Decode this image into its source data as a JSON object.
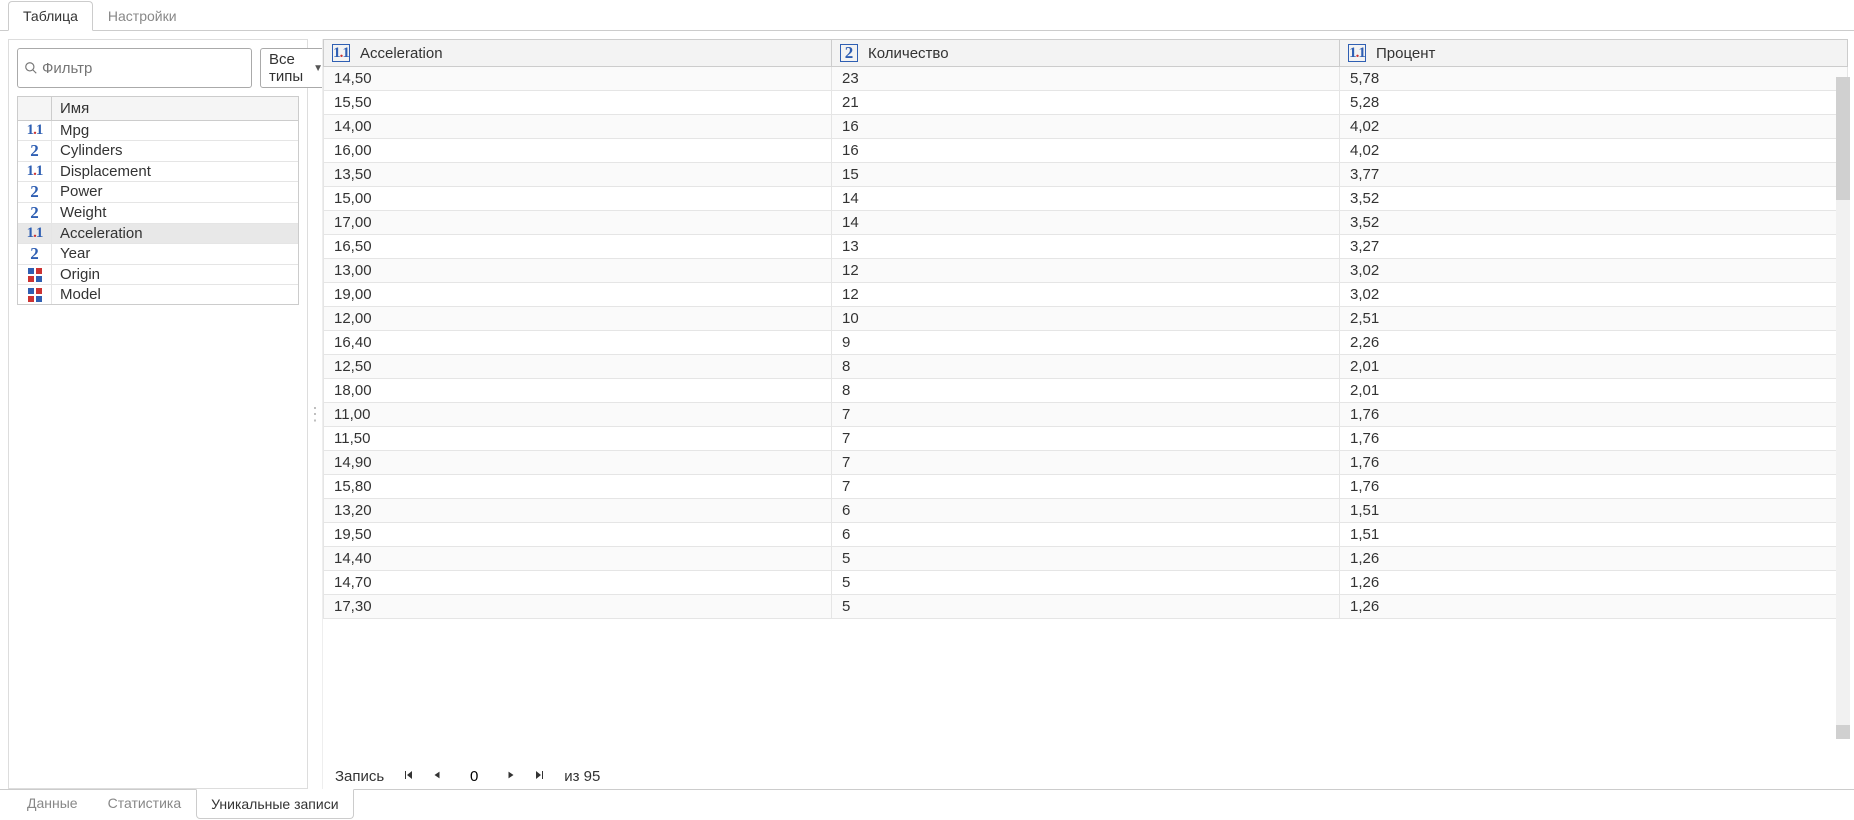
{
  "top_tabs": [
    {
      "label": "Таблица",
      "active": true
    },
    {
      "label": "Настройки",
      "active": false
    }
  ],
  "left": {
    "filter_placeholder": "Фильтр",
    "type_select_label": "Все типы",
    "name_header": "Имя",
    "fields": [
      {
        "name": "Mpg",
        "type": "decimal",
        "selected": false
      },
      {
        "name": "Cylinders",
        "type": "int",
        "selected": false
      },
      {
        "name": "Displacement",
        "type": "decimal",
        "selected": false
      },
      {
        "name": "Power",
        "type": "int",
        "selected": false
      },
      {
        "name": "Weight",
        "type": "int",
        "selected": false
      },
      {
        "name": "Acceleration",
        "type": "decimal",
        "selected": true
      },
      {
        "name": "Year",
        "type": "int",
        "selected": false
      },
      {
        "name": "Origin",
        "type": "cat",
        "selected": false
      },
      {
        "name": "Model",
        "type": "cat",
        "selected": false
      }
    ]
  },
  "data": {
    "columns": [
      {
        "label": "Acceleration",
        "type": "decimal"
      },
      {
        "label": "Количество",
        "type": "int"
      },
      {
        "label": "Процент",
        "type": "decimal"
      }
    ],
    "rows": [
      [
        "14,50",
        "23",
        "5,78"
      ],
      [
        "15,50",
        "21",
        "5,28"
      ],
      [
        "14,00",
        "16",
        "4,02"
      ],
      [
        "16,00",
        "16",
        "4,02"
      ],
      [
        "13,50",
        "15",
        "3,77"
      ],
      [
        "15,00",
        "14",
        "3,52"
      ],
      [
        "17,00",
        "14",
        "3,52"
      ],
      [
        "16,50",
        "13",
        "3,27"
      ],
      [
        "13,00",
        "12",
        "3,02"
      ],
      [
        "19,00",
        "12",
        "3,02"
      ],
      [
        "12,00",
        "10",
        "2,51"
      ],
      [
        "16,40",
        "9",
        "2,26"
      ],
      [
        "12,50",
        "8",
        "2,01"
      ],
      [
        "18,00",
        "8",
        "2,01"
      ],
      [
        "11,00",
        "7",
        "1,76"
      ],
      [
        "11,50",
        "7",
        "1,76"
      ],
      [
        "14,90",
        "7",
        "1,76"
      ],
      [
        "15,80",
        "7",
        "1,76"
      ],
      [
        "13,20",
        "6",
        "1,51"
      ],
      [
        "19,50",
        "6",
        "1,51"
      ],
      [
        "14,40",
        "5",
        "1,26"
      ],
      [
        "14,70",
        "5",
        "1,26"
      ],
      [
        "17,30",
        "5",
        "1,26"
      ]
    ]
  },
  "pager": {
    "label": "Запись",
    "current": "0",
    "of_label": "из",
    "total": "95"
  },
  "bottom_tabs": [
    {
      "label": "Данные",
      "active": false
    },
    {
      "label": "Статистика",
      "active": false
    },
    {
      "label": "Уникальные записи",
      "active": true
    }
  ]
}
